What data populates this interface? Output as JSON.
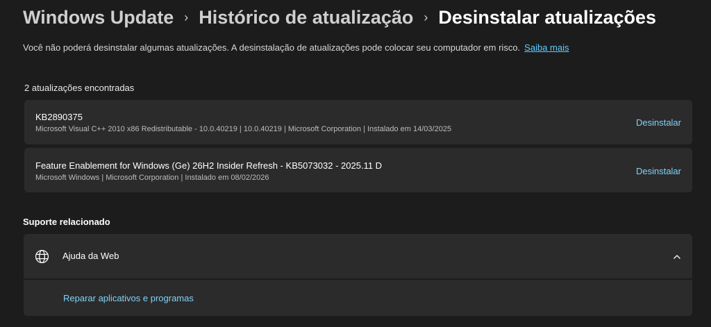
{
  "breadcrumb": {
    "items": [
      "Windows Update",
      "Histórico de atualização",
      "Desinstalar atualizações"
    ],
    "separator": "›"
  },
  "warning": {
    "text": "Você não poderá desinstalar algumas atualizações. A desinstalação de atualizações pode colocar seu computador em risco.",
    "link": "Saiba mais"
  },
  "updates": {
    "count_text": "2 atualizações encontradas",
    "items": [
      {
        "title": "KB2890375",
        "details": "Microsoft Visual C++ 2010  x86 Redistributable - 10.0.40219  |  10.0.40219  |  Microsoft Corporation  |  Instalado em 14/03/2025",
        "action": "Desinstalar"
      },
      {
        "title": "Feature Enablement for Windows (Ge) 26H2 Insider Refresh - KB5073032 - 2025.11 D",
        "details": "Microsoft Windows  |  Microsoft Corporation  |  Instalado em 08/02/2026",
        "action": "Desinstalar"
      }
    ]
  },
  "support": {
    "section_title": "Suporte relacionado",
    "header_label": "Ajuda da Web",
    "header_icon": "globe-icon",
    "expanded_icon": "chevron-up-icon",
    "link": "Reparar aplicativos e programas"
  },
  "colors": {
    "background": "#1c1c1c",
    "card": "#2b2b2b",
    "accent": "#60cdff"
  }
}
